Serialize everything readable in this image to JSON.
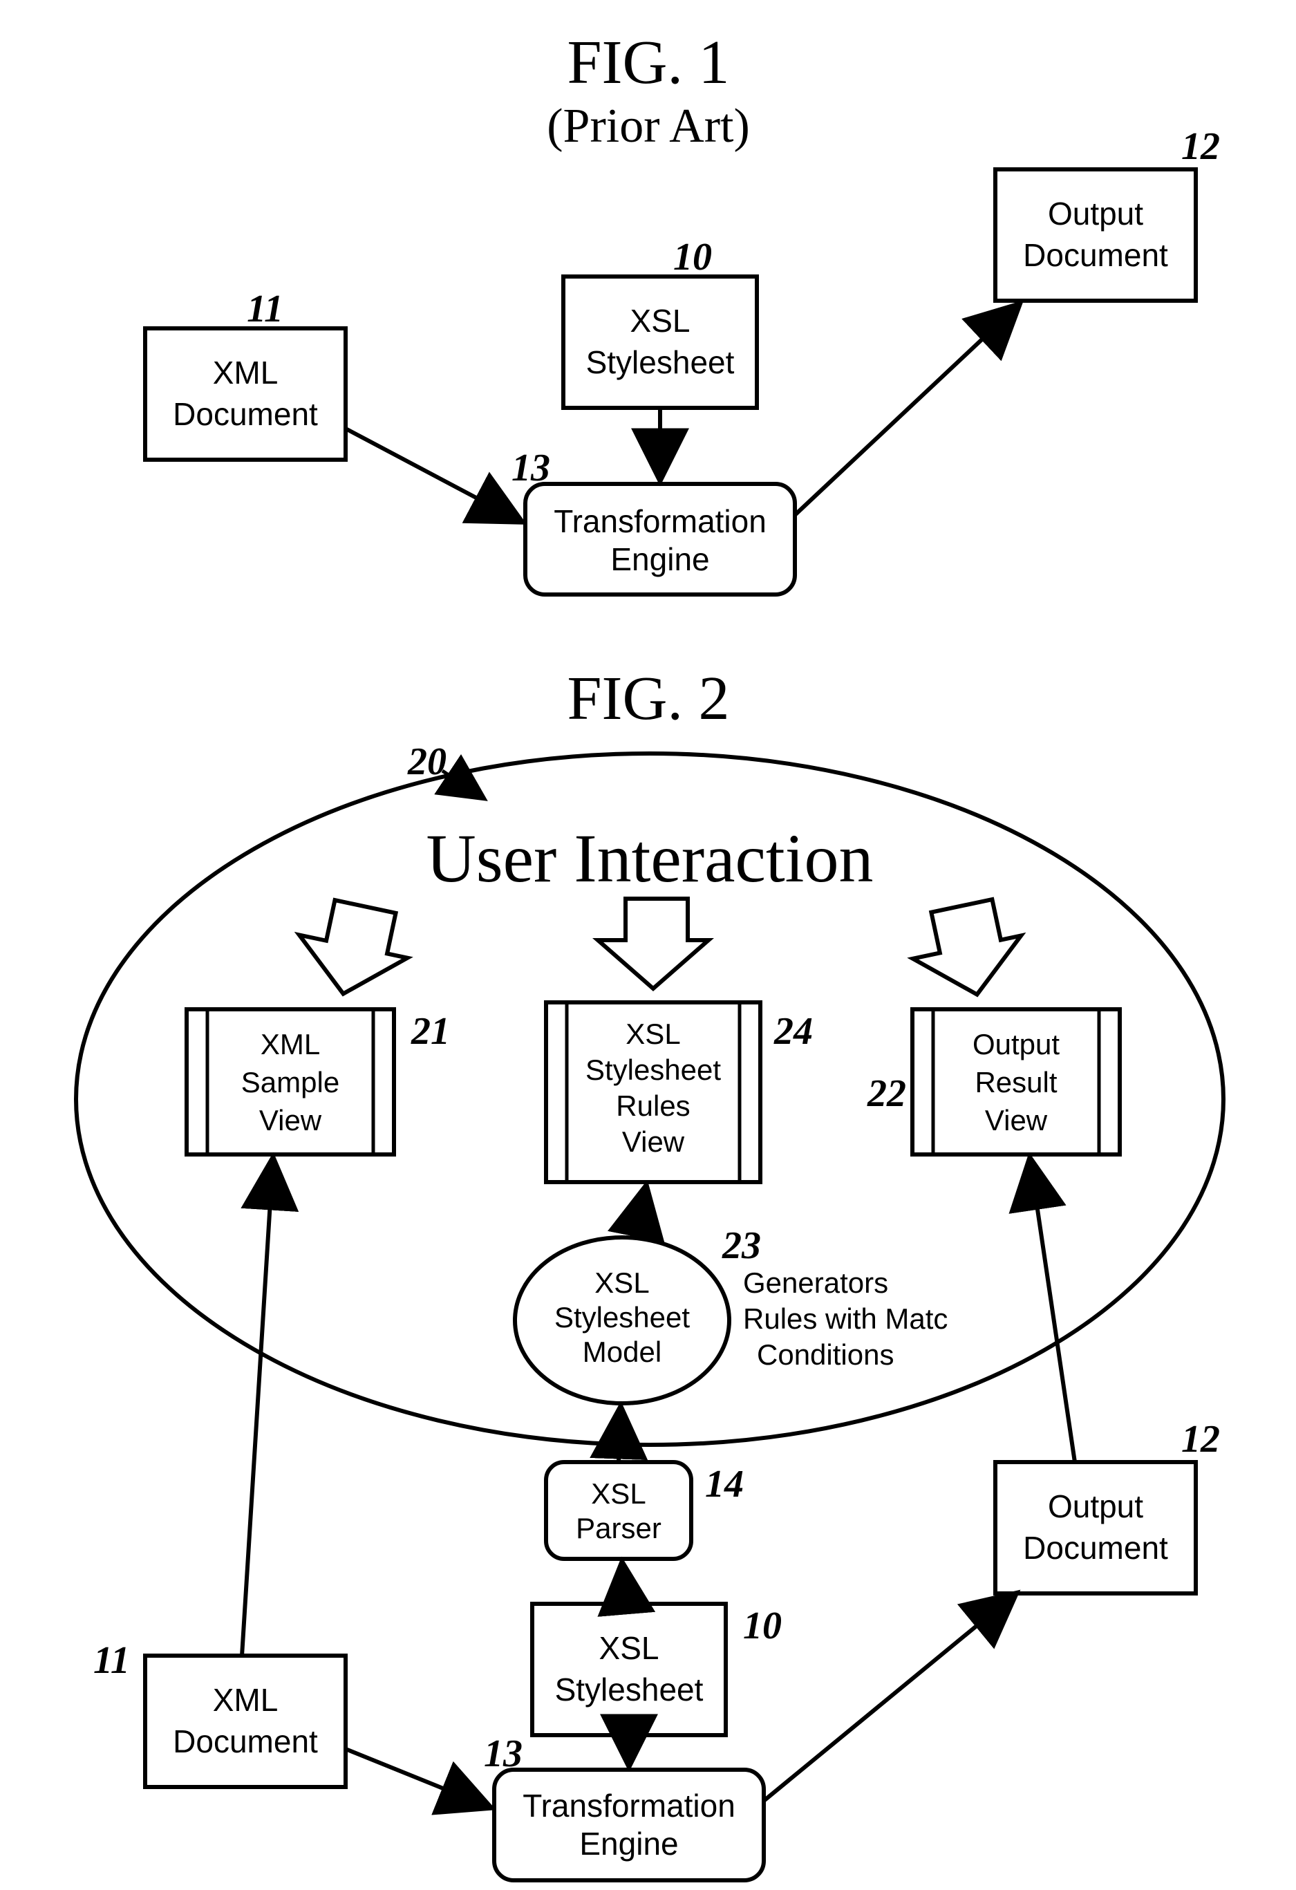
{
  "fig1": {
    "title": "FIG. 1",
    "subtitle": "(Prior Art)",
    "refs": {
      "r10": "10",
      "r11": "11",
      "r12": "12",
      "r13": "13"
    },
    "boxes": {
      "xml": {
        "l1": "XML",
        "l2": "Document"
      },
      "xsl": {
        "l1": "XSL",
        "l2": "Stylesheet"
      },
      "out": {
        "l1": "Output",
        "l2": "Document"
      },
      "trans": {
        "l1": "Transformation",
        "l2": "Engine"
      }
    }
  },
  "fig2": {
    "title": "FIG. 2",
    "bigtitle": "User Interaction",
    "refs": {
      "r10": "10",
      "r11": "11",
      "r12": "12",
      "r13": "13",
      "r14": "14",
      "r20": "20",
      "r21": "21",
      "r22": "22",
      "r23": "23",
      "r24": "24"
    },
    "boxes": {
      "xml": {
        "l1": "XML",
        "l2": "Document"
      },
      "xsl": {
        "l1": "XSL",
        "l2": "Stylesheet"
      },
      "out": {
        "l1": "Output",
        "l2": "Document"
      },
      "trans": {
        "l1": "Transformation",
        "l2": "Engine"
      },
      "xslparser": {
        "l1": "XSL",
        "l2": "Parser"
      },
      "xslmodel": {
        "l1": "XSL",
        "l2": "Stylesheet",
        "l3": "Model"
      },
      "xmlsample": {
        "l1": "XML",
        "l2": "Sample",
        "l3": "View"
      },
      "xslrules": {
        "l1": "XSL",
        "l2": "Stylesheet",
        "l3": "Rules",
        "l4": "View"
      },
      "outresult": {
        "l1": "Output",
        "l2": "Result",
        "l3": "View"
      }
    },
    "annot": {
      "l1": "Generators",
      "l2": "Rules with Matc",
      "l3": "Conditions"
    }
  }
}
